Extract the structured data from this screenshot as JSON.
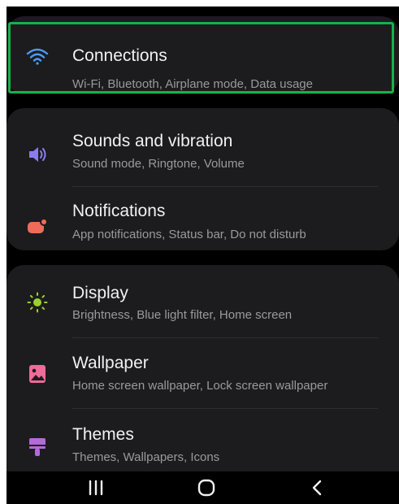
{
  "settings": {
    "connections": {
      "title": "Connections",
      "subtitle": "Wi-Fi, Bluetooth, Airplane mode, Data usage",
      "icon": "wifi-icon",
      "color": "#4a9cf5"
    },
    "sounds": {
      "title": "Sounds and vibration",
      "subtitle": "Sound mode, Ringtone, Volume",
      "icon": "volume-icon",
      "color": "#8a7cf0"
    },
    "notifications": {
      "title": "Notifications",
      "subtitle": "App notifications, Status bar, Do not disturb",
      "icon": "notification-icon",
      "color": "#f06b5a"
    },
    "display": {
      "title": "Display",
      "subtitle": "Brightness, Blue light filter, Home screen",
      "icon": "brightness-icon",
      "color": "#9bd12f"
    },
    "wallpaper": {
      "title": "Wallpaper",
      "subtitle": "Home screen wallpaper, Lock screen wallpaper",
      "icon": "wallpaper-icon",
      "color": "#f06a9a"
    },
    "themes": {
      "title": "Themes",
      "subtitle": "Themes, Wallpapers, Icons",
      "icon": "themes-icon",
      "color": "#b46ad8"
    }
  },
  "highlight_color": "#16b14b",
  "navbar": {
    "buttons": [
      "recent-apps-button",
      "home-button",
      "back-button"
    ]
  }
}
